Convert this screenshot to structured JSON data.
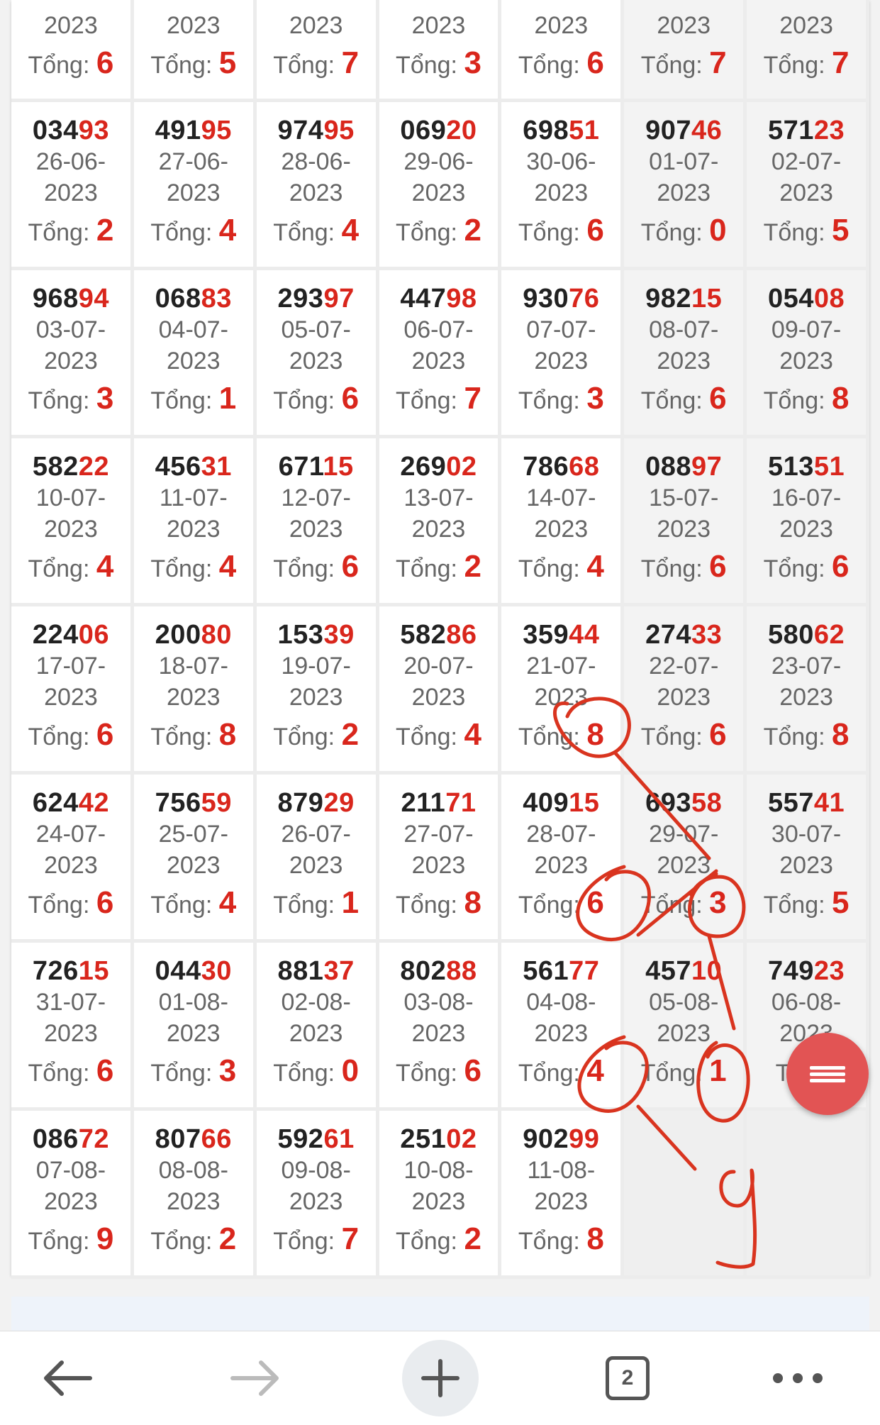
{
  "label_tong": "Tổng:",
  "rows": [
    [
      {
        "num_head": "",
        "num_tail": "",
        "date_line1": "",
        "date_line2": "2023",
        "tong": "6",
        "weekend": false
      },
      {
        "num_head": "",
        "num_tail": "",
        "date_line1": "",
        "date_line2": "2023",
        "tong": "5",
        "weekend": false
      },
      {
        "num_head": "",
        "num_tail": "",
        "date_line1": "",
        "date_line2": "2023",
        "tong": "7",
        "weekend": false
      },
      {
        "num_head": "",
        "num_tail": "",
        "date_line1": "",
        "date_line2": "2023",
        "tong": "3",
        "weekend": false
      },
      {
        "num_head": "",
        "num_tail": "",
        "date_line1": "",
        "date_line2": "2023",
        "tong": "6",
        "weekend": false
      },
      {
        "num_head": "",
        "num_tail": "",
        "date_line1": "",
        "date_line2": "2023",
        "tong": "7",
        "weekend": true
      },
      {
        "num_head": "",
        "num_tail": "",
        "date_line1": "",
        "date_line2": "2023",
        "tong": "7",
        "weekend": true
      }
    ],
    [
      {
        "num_head": "034",
        "num_tail": "93",
        "date_line1": "26-06-",
        "date_line2": "2023",
        "tong": "2",
        "weekend": false
      },
      {
        "num_head": "491",
        "num_tail": "95",
        "date_line1": "27-06-",
        "date_line2": "2023",
        "tong": "4",
        "weekend": false
      },
      {
        "num_head": "974",
        "num_tail": "95",
        "date_line1": "28-06-",
        "date_line2": "2023",
        "tong": "4",
        "weekend": false
      },
      {
        "num_head": "069",
        "num_tail": "20",
        "date_line1": "29-06-",
        "date_line2": "2023",
        "tong": "2",
        "weekend": false
      },
      {
        "num_head": "698",
        "num_tail": "51",
        "date_line1": "30-06-",
        "date_line2": "2023",
        "tong": "6",
        "weekend": false
      },
      {
        "num_head": "907",
        "num_tail": "46",
        "date_line1": "01-07-",
        "date_line2": "2023",
        "tong": "0",
        "weekend": true
      },
      {
        "num_head": "571",
        "num_tail": "23",
        "date_line1": "02-07-",
        "date_line2": "2023",
        "tong": "5",
        "weekend": true
      }
    ],
    [
      {
        "num_head": "968",
        "num_tail": "94",
        "date_line1": "03-07-",
        "date_line2": "2023",
        "tong": "3",
        "weekend": false
      },
      {
        "num_head": "068",
        "num_tail": "83",
        "date_line1": "04-07-",
        "date_line2": "2023",
        "tong": "1",
        "weekend": false
      },
      {
        "num_head": "293",
        "num_tail": "97",
        "date_line1": "05-07-",
        "date_line2": "2023",
        "tong": "6",
        "weekend": false
      },
      {
        "num_head": "447",
        "num_tail": "98",
        "date_line1": "06-07-",
        "date_line2": "2023",
        "tong": "7",
        "weekend": false
      },
      {
        "num_head": "930",
        "num_tail": "76",
        "date_line1": "07-07-",
        "date_line2": "2023",
        "tong": "3",
        "weekend": false
      },
      {
        "num_head": "982",
        "num_tail": "15",
        "date_line1": "08-07-",
        "date_line2": "2023",
        "tong": "6",
        "weekend": true
      },
      {
        "num_head": "054",
        "num_tail": "08",
        "date_line1": "09-07-",
        "date_line2": "2023",
        "tong": "8",
        "weekend": true
      }
    ],
    [
      {
        "num_head": "582",
        "num_tail": "22",
        "date_line1": "10-07-",
        "date_line2": "2023",
        "tong": "4",
        "weekend": false
      },
      {
        "num_head": "456",
        "num_tail": "31",
        "date_line1": "11-07-",
        "date_line2": "2023",
        "tong": "4",
        "weekend": false
      },
      {
        "num_head": "671",
        "num_tail": "15",
        "date_line1": "12-07-",
        "date_line2": "2023",
        "tong": "6",
        "weekend": false
      },
      {
        "num_head": "269",
        "num_tail": "02",
        "date_line1": "13-07-",
        "date_line2": "2023",
        "tong": "2",
        "weekend": false
      },
      {
        "num_head": "786",
        "num_tail": "68",
        "date_line1": "14-07-",
        "date_line2": "2023",
        "tong": "4",
        "weekend": false
      },
      {
        "num_head": "088",
        "num_tail": "97",
        "date_line1": "15-07-",
        "date_line2": "2023",
        "tong": "6",
        "weekend": true
      },
      {
        "num_head": "513",
        "num_tail": "51",
        "date_line1": "16-07-",
        "date_line2": "2023",
        "tong": "6",
        "weekend": true
      }
    ],
    [
      {
        "num_head": "224",
        "num_tail": "06",
        "date_line1": "17-07-",
        "date_line2": "2023",
        "tong": "6",
        "weekend": false
      },
      {
        "num_head": "200",
        "num_tail": "80",
        "date_line1": "18-07-",
        "date_line2": "2023",
        "tong": "8",
        "weekend": false
      },
      {
        "num_head": "153",
        "num_tail": "39",
        "date_line1": "19-07-",
        "date_line2": "2023",
        "tong": "2",
        "weekend": false
      },
      {
        "num_head": "582",
        "num_tail": "86",
        "date_line1": "20-07-",
        "date_line2": "2023",
        "tong": "4",
        "weekend": false
      },
      {
        "num_head": "359",
        "num_tail": "44",
        "date_line1": "21-07-",
        "date_line2": "2023",
        "tong": "8",
        "weekend": false
      },
      {
        "num_head": "274",
        "num_tail": "33",
        "date_line1": "22-07-",
        "date_line2": "2023",
        "tong": "6",
        "weekend": true
      },
      {
        "num_head": "580",
        "num_tail": "62",
        "date_line1": "23-07-",
        "date_line2": "2023",
        "tong": "8",
        "weekend": true
      }
    ],
    [
      {
        "num_head": "624",
        "num_tail": "42",
        "date_line1": "24-07-",
        "date_line2": "2023",
        "tong": "6",
        "weekend": false
      },
      {
        "num_head": "756",
        "num_tail": "59",
        "date_line1": "25-07-",
        "date_line2": "2023",
        "tong": "4",
        "weekend": false
      },
      {
        "num_head": "879",
        "num_tail": "29",
        "date_line1": "26-07-",
        "date_line2": "2023",
        "tong": "1",
        "weekend": false
      },
      {
        "num_head": "211",
        "num_tail": "71",
        "date_line1": "27-07-",
        "date_line2": "2023",
        "tong": "8",
        "weekend": false
      },
      {
        "num_head": "409",
        "num_tail": "15",
        "date_line1": "28-07-",
        "date_line2": "2023",
        "tong": "6",
        "weekend": false
      },
      {
        "num_head": "693",
        "num_tail": "58",
        "date_line1": "29-07-",
        "date_line2": "2023",
        "tong": "3",
        "weekend": true
      },
      {
        "num_head": "557",
        "num_tail": "41",
        "date_line1": "30-07-",
        "date_line2": "2023",
        "tong": "5",
        "weekend": true
      }
    ],
    [
      {
        "num_head": "726",
        "num_tail": "15",
        "date_line1": "31-07-",
        "date_line2": "2023",
        "tong": "6",
        "weekend": false
      },
      {
        "num_head": "044",
        "num_tail": "30",
        "date_line1": "01-08-",
        "date_line2": "2023",
        "tong": "3",
        "weekend": false
      },
      {
        "num_head": "881",
        "num_tail": "37",
        "date_line1": "02-08-",
        "date_line2": "2023",
        "tong": "0",
        "weekend": false
      },
      {
        "num_head": "802",
        "num_tail": "88",
        "date_line1": "03-08-",
        "date_line2": "2023",
        "tong": "6",
        "weekend": false
      },
      {
        "num_head": "561",
        "num_tail": "77",
        "date_line1": "04-08-",
        "date_line2": "2023",
        "tong": "4",
        "weekend": false
      },
      {
        "num_head": "457",
        "num_tail": "10",
        "date_line1": "05-08-",
        "date_line2": "2023",
        "tong": "1",
        "weekend": true
      },
      {
        "num_head": "749",
        "num_tail": "23",
        "date_line1": "06-08-",
        "date_line2": "2023",
        "tong": "",
        "weekend": true
      }
    ],
    [
      {
        "num_head": "086",
        "num_tail": "72",
        "date_line1": "07-08-",
        "date_line2": "2023",
        "tong": "9",
        "weekend": false
      },
      {
        "num_head": "807",
        "num_tail": "66",
        "date_line1": "08-08-",
        "date_line2": "2023",
        "tong": "2",
        "weekend": false
      },
      {
        "num_head": "592",
        "num_tail": "61",
        "date_line1": "09-08-",
        "date_line2": "2023",
        "tong": "7",
        "weekend": false
      },
      {
        "num_head": "251",
        "num_tail": "02",
        "date_line1": "10-08-",
        "date_line2": "2023",
        "tong": "2",
        "weekend": false
      },
      {
        "num_head": "902",
        "num_tail": "99",
        "date_line1": "11-08-",
        "date_line2": "2023",
        "tong": "8",
        "weekend": false
      },
      {
        "empty": true
      },
      {
        "empty": true
      }
    ]
  ],
  "annotation": {
    "written_digit": "9",
    "color": "#d9341f"
  },
  "fab": {
    "icon": "menu-icon",
    "color": "#e25454"
  },
  "bottom_bar": {
    "tab_count": "2",
    "icons": [
      "back-arrow-icon",
      "forward-arrow-icon",
      "plus-icon",
      "tabs-icon",
      "more-dots-icon"
    ]
  },
  "colors": {
    "accent_red": "#d9261c",
    "number_dark": "#222222",
    "text_gray": "#666666"
  }
}
